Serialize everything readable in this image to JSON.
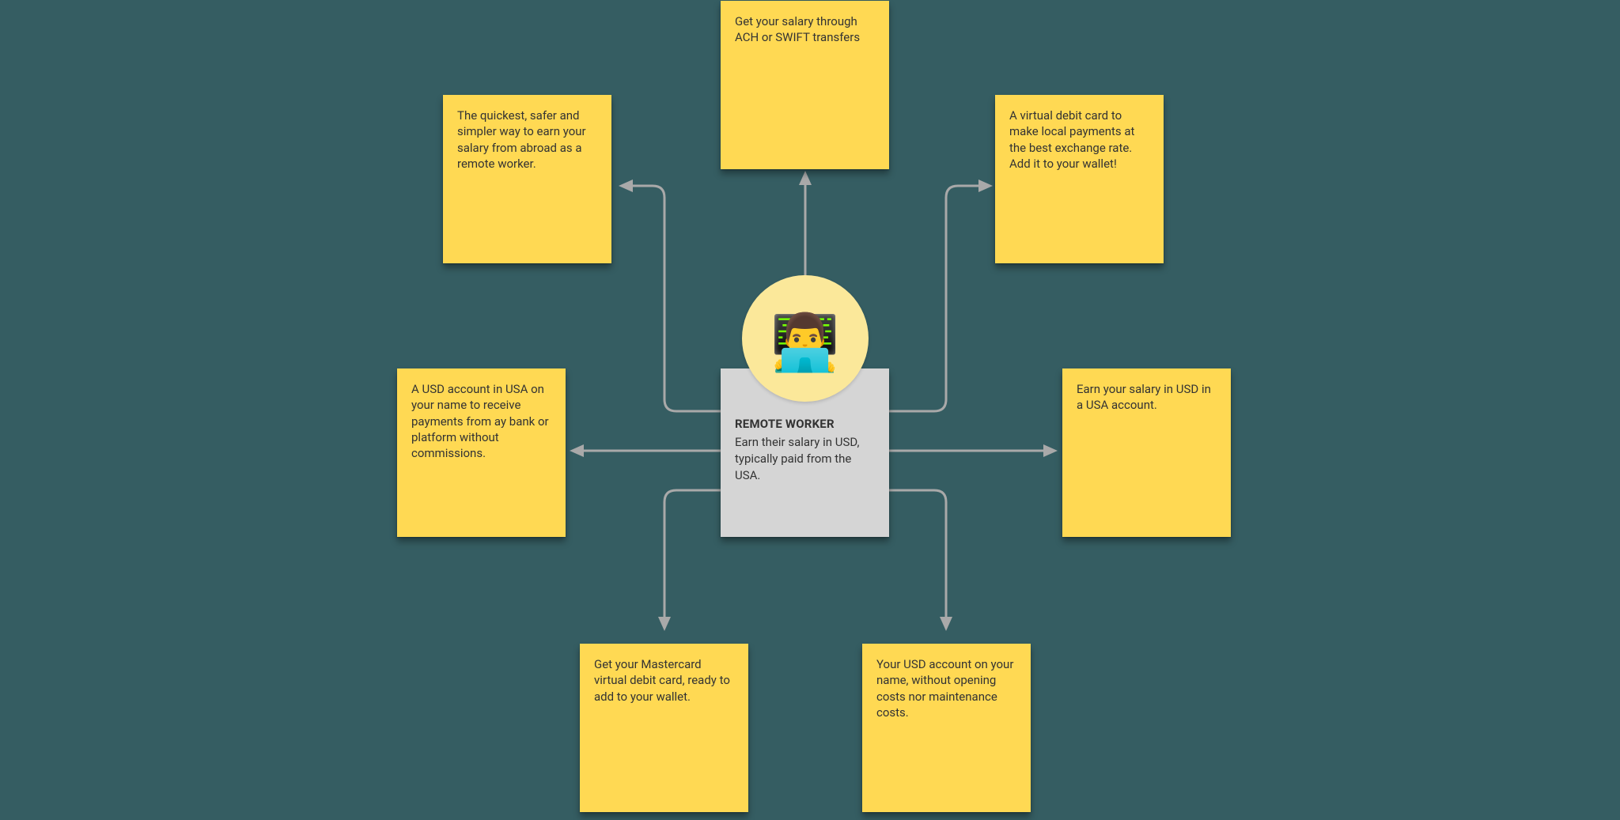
{
  "center": {
    "title": "REMOTE WORKER",
    "description": "Earn their salary in USD, typically paid from the USA.",
    "emoji": "👨‍💻"
  },
  "notes": {
    "top": "Get your salary through ACH or SWIFT transfers",
    "top_left": "The quickest, safer and simpler way to earn your salary from abroad as a remote worker.",
    "top_right": "A virtual debit card to make local payments at the best exchange rate. Add it to your wallet!",
    "left": "A USD account in USA on your name to receive payments from ay bank or platform without commissions.",
    "right": "Earn your salary in USD in a USA account.",
    "bottom_left": "Get your Mastercard virtual debit card, ready to add to your wallet.",
    "bottom_right": "Your USD account on your name, without opening costs nor maintenance costs."
  }
}
